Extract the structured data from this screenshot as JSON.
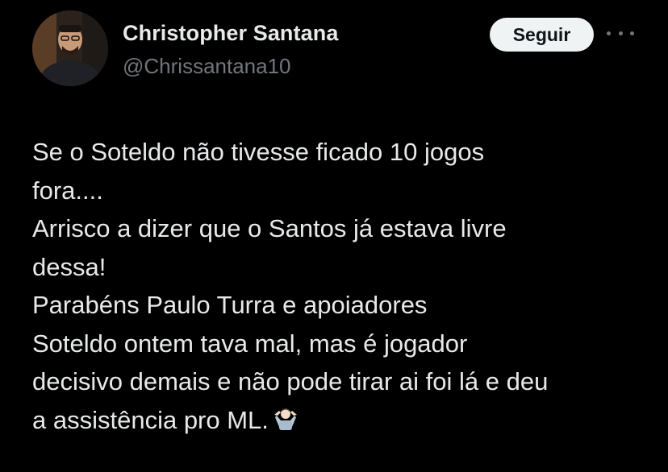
{
  "author": {
    "display_name": "Christopher Santana",
    "handle": "@Chrissantana10"
  },
  "actions": {
    "follow_label": "Seguir",
    "more_icon": "more-horizontal-icon"
  },
  "tweet": {
    "lines": [
      "Se o Soteldo não tivesse ficado 10 jogos",
      "fora....",
      "Arrisco a dizer que o Santos já estava livre",
      "dessa!",
      "Parabéns Paulo Turra e apoiadores",
      "Soteldo ontem tava mal, mas é jogador",
      "decisivo demais e não pode tirar ai foi lá e deu",
      "a assistência pro ML."
    ],
    "trailing_emoji": "person-shrugging-emoji"
  },
  "colors": {
    "background": "#000000",
    "primary_text": "#e7e9ea",
    "secondary_text": "#71767b",
    "follow_button_bg": "#eff3f4",
    "follow_button_text": "#0f1419"
  }
}
